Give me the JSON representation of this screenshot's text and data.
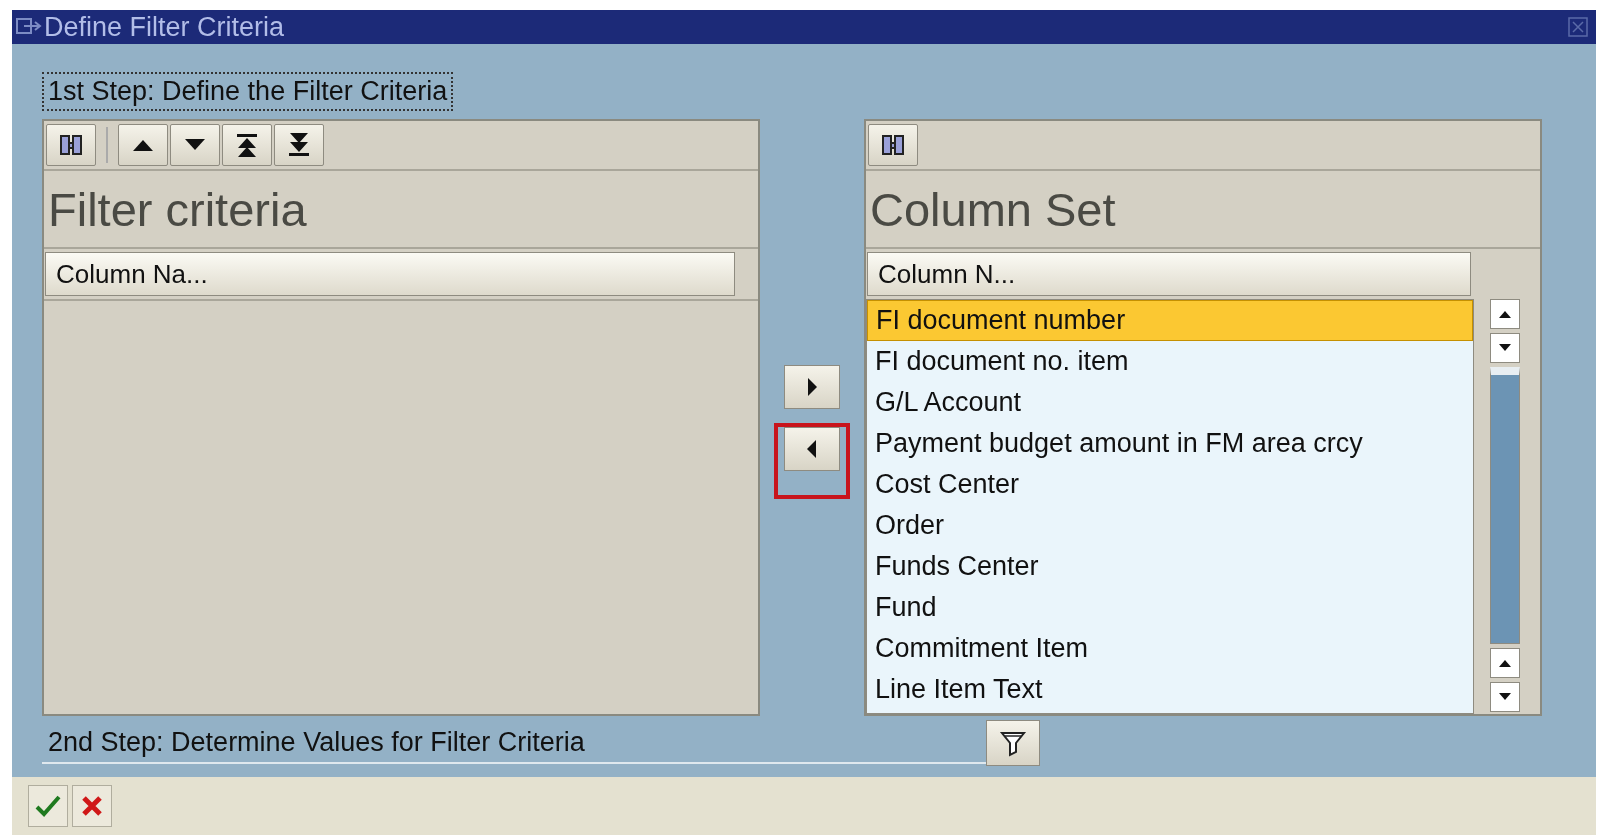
{
  "window": {
    "title": "Define Filter Criteria"
  },
  "step1": {
    "label": "1st Step: Define the Filter Criteria"
  },
  "left_panel": {
    "title": "Filter criteria",
    "column_header": "Column Na..."
  },
  "move_buttons": [
    {
      "kind": "right",
      "highlighted": false
    },
    {
      "kind": "left",
      "highlighted": true
    }
  ],
  "right_panel": {
    "title": "Column Set",
    "column_header": "Column N...",
    "rows": [
      {
        "label": "FI document number",
        "selected": true
      },
      {
        "label": "FI document no. item",
        "selected": false
      },
      {
        "label": "G/L Account",
        "selected": false
      },
      {
        "label": "Payment budget amount in FM area crcy",
        "selected": false
      },
      {
        "label": "Cost Center",
        "selected": false
      },
      {
        "label": "Order",
        "selected": false
      },
      {
        "label": "Funds Center",
        "selected": false
      },
      {
        "label": "Fund",
        "selected": false
      },
      {
        "label": "Commitment Item",
        "selected": false
      },
      {
        "label": "Line Item Text",
        "selected": false
      }
    ]
  },
  "step2": {
    "label": "2nd Step: Determine Values for Filter Criteria"
  }
}
